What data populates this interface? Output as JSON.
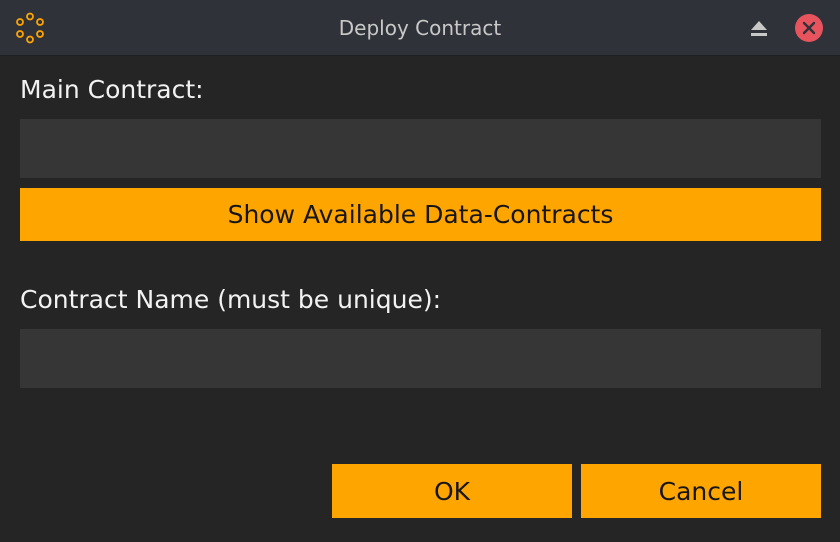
{
  "window": {
    "title": "Deploy Contract",
    "app_icon": "app-logo-dots-icon",
    "controls": {
      "collapse_icon": "eject-icon",
      "close_icon": "close-icon"
    }
  },
  "form": {
    "main_contract": {
      "label": "Main Contract:",
      "value": "",
      "placeholder": ""
    },
    "show_contracts_button": "Show Available Data-Contracts",
    "contract_name": {
      "label": "Contract Name (must be unique):",
      "value": "",
      "placeholder": ""
    }
  },
  "actions": {
    "ok_label": "OK",
    "cancel_label": "Cancel"
  },
  "colors": {
    "accent": "#ffa500",
    "background": "#252525",
    "titlebar": "#2f3238",
    "field": "#363636",
    "close": "#e8545e"
  }
}
